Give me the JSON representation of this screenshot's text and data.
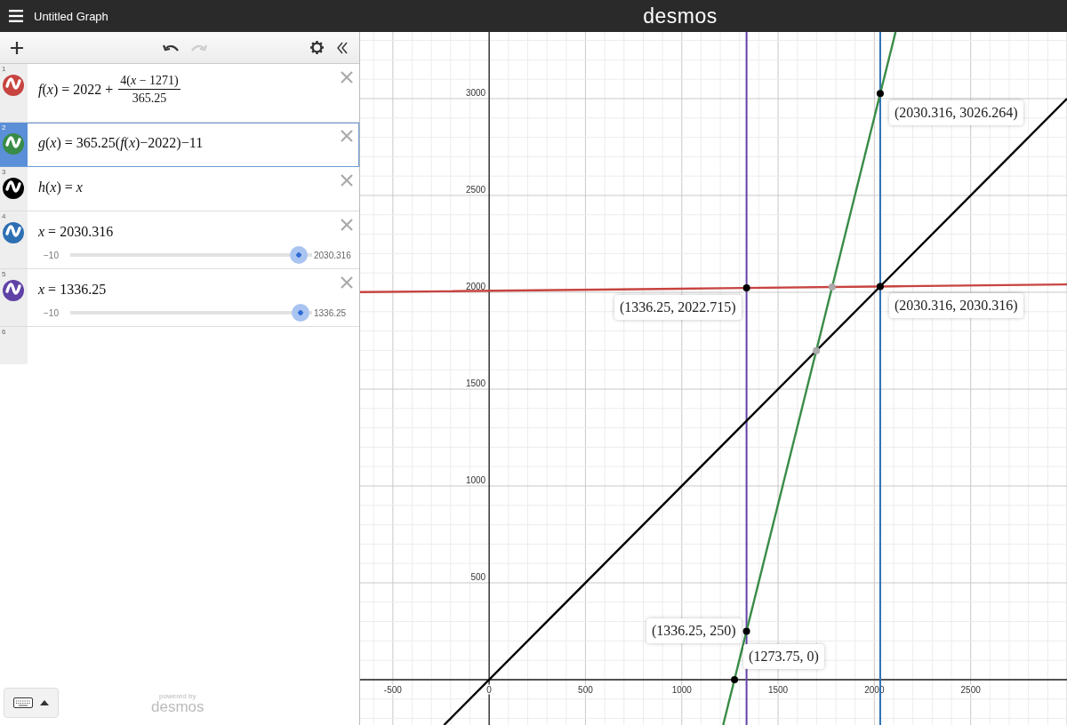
{
  "header": {
    "title": "Untitled Graph",
    "logo": "desmos"
  },
  "toolbar": {
    "undo_disabled": false,
    "redo_disabled": true
  },
  "expressions": [
    {
      "index": "1",
      "kind": "fraction",
      "color": "#c74440",
      "selected": false,
      "lhs": "*f*(*x*) = 2022 +",
      "numerator": "4(*x* − 1271)",
      "denominator": "365.25"
    },
    {
      "index": "2",
      "kind": "plain",
      "color": "#388c46",
      "selected": true,
      "text": "*g*(*x*) = 365.25(*f*(*x*)−2022)−11"
    },
    {
      "index": "3",
      "kind": "plain",
      "color": "#000000",
      "selected": false,
      "text": "*h*(*x*) = *x*"
    },
    {
      "index": "4",
      "kind": "slider",
      "color": "#2d70b3",
      "selected": false,
      "text": "*x* = 2030.316",
      "min": "−10",
      "value": "2030.316",
      "level": 0.98
    },
    {
      "index": "5",
      "kind": "slider",
      "color": "#6042a6",
      "selected": false,
      "text": "*x* = 1336.25",
      "min": "−10",
      "value": "1336.25",
      "level": 0.99
    },
    {
      "index": "6",
      "kind": "empty",
      "selected": false
    }
  ],
  "footer": {
    "powered_by": "powered by",
    "brand": "desmos"
  },
  "graph": {
    "chart_data": {
      "type": "line",
      "x": [
        -670,
        -234,
        1215,
        2110,
        3000
      ],
      "series": [
        {
          "color": "#c74440",
          "values": [
            2001,
            2005,
            2021,
            2031,
            2041
          ]
        },
        {
          "color": "#388c46",
          "values": [
            null,
            null,
            -234,
            3344,
            null
          ]
        },
        {
          "color": "#000000",
          "values": [
            null,
            -234,
            1215,
            2110,
            3000
          ]
        }
      ],
      "xlim": [
        -670,
        3000
      ],
      "ylim": [
        -234,
        3344
      ],
      "xticks": [
        -500,
        0,
        500,
        1000,
        1500,
        2000,
        2500
      ],
      "yticks": [
        500,
        1000,
        1500,
        2000,
        2500,
        3000
      ],
      "grid": true,
      "ref_lines": [
        {
          "axis": "x",
          "value": 1336.25,
          "color": "#6042a6"
        },
        {
          "axis": "x",
          "value": 2030.316,
          "color": "#2d70b3"
        }
      ],
      "annotations": [
        {
          "x": 2030.316,
          "y": 3026.264,
          "text": "(2030.316, 3026.264)"
        },
        {
          "x": 1336.25,
          "y": 2022.715,
          "text": "(1336.25, 2022.715)"
        },
        {
          "x": 2030.316,
          "y": 2030.316,
          "text": "(2030.316, 2030.316)"
        },
        {
          "x": 1336.25,
          "y": 250,
          "text": "(1336.25, 250)"
        },
        {
          "x": 1273.75,
          "y": 0,
          "text": "(1273.75, 0)"
        }
      ]
    }
  }
}
